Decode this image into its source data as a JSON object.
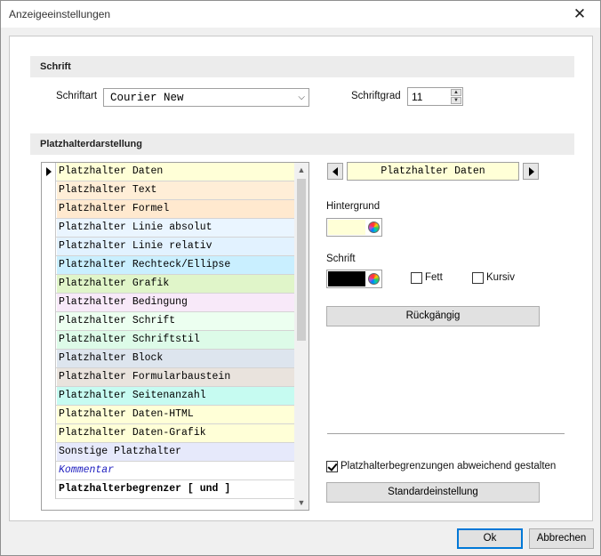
{
  "window": {
    "title": "Anzeigeeinstellungen",
    "close_glyph": "✕"
  },
  "schrift_section": {
    "header": "Schrift",
    "schriftart_label": "Schriftart",
    "schriftart_value": "Courier New",
    "schriftgrad_label": "Schriftgrad",
    "schriftgrad_value": "11"
  },
  "platzhalter_section": {
    "header": "Platzhalterdarstellung",
    "rows": [
      {
        "label": "Platzhalter Daten",
        "bg": "#ffffd7",
        "color": "#000000",
        "selected": true
      },
      {
        "label": "Platzhalter Text",
        "bg": "#ffeed7",
        "color": "#000000"
      },
      {
        "label": "Platzhalter Formel",
        "bg": "#ffe9cf",
        "color": "#000000"
      },
      {
        "label": "Platzhalter Linie absolut",
        "bg": "#eaf5ff",
        "color": "#000000"
      },
      {
        "label": "Platzhalter Linie relativ",
        "bg": "#e2f2ff",
        "color": "#000000"
      },
      {
        "label": "Platzhalter Rechteck/Ellipse",
        "bg": "#c9efff",
        "color": "#000000"
      },
      {
        "label": "Platzhalter Grafik",
        "bg": "#e0f5c9",
        "color": "#000000"
      },
      {
        "label": "Platzhalter Bedingung",
        "bg": "#f8e9f9",
        "color": "#000000"
      },
      {
        "label": "Platzhalter Schrift",
        "bg": "#ecfff0",
        "color": "#000000"
      },
      {
        "label": "Platzhalter Schriftstil",
        "bg": "#ddfbe8",
        "color": "#000000"
      },
      {
        "label": "Platzhalter Block",
        "bg": "#dde5ee",
        "color": "#000000"
      },
      {
        "label": "Platzhalter Formularbaustein",
        "bg": "#e9e3dd",
        "color": "#000000"
      },
      {
        "label": "Platzhalter Seitenanzahl",
        "bg": "#c6fbf1",
        "color": "#000000"
      },
      {
        "label": "Platzhalter Daten-HTML",
        "bg": "#ffffd7",
        "color": "#000000"
      },
      {
        "label": "Platzhalter Daten-Grafik",
        "bg": "#ffffd7",
        "color": "#000000"
      },
      {
        "label": "Sonstige Platzhalter",
        "bg": "#e6e9fb",
        "color": "#000000"
      },
      {
        "label": "Kommentar",
        "bg": "#ffffff",
        "color": "#1e1ebf",
        "italic": true
      },
      {
        "label": "Platzhalterbegrenzer [ und ]",
        "bg": "#ffffff",
        "color": "#000000",
        "bold": true
      }
    ],
    "preview_text": "Platzhalter Daten",
    "preview_bg": "#ffffd7",
    "hintergrund_label": "Hintergrund",
    "hintergrund_color": "#ffffd7",
    "schrift_label": "Schrift",
    "schrift_color": "#000000",
    "fett_label": "Fett",
    "kursiv_label": "Kursiv",
    "rueckgaengig_label": "Rückgängig",
    "begrenzungen_label": "Platzhalterbegrenzungen abweichend gestalten",
    "standard_label": "Standardeinstellung"
  },
  "footer": {
    "ok_label": "Ok",
    "cancel_label": "Abbrechen"
  }
}
